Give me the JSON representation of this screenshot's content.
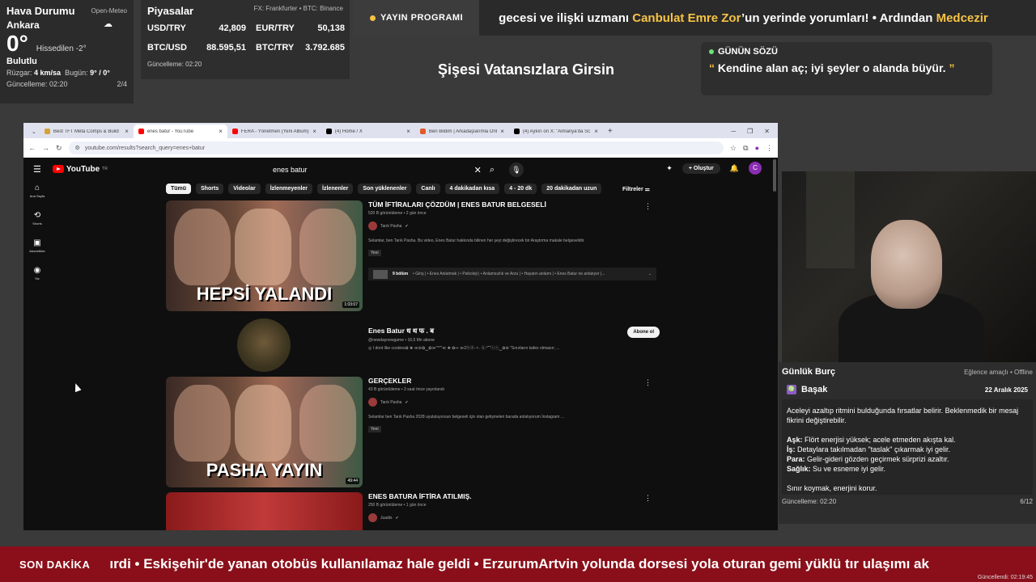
{
  "weather": {
    "title": "Hava Durumu",
    "source": "Open-Meteo",
    "city": "Ankara",
    "temp": "0°",
    "feels_like": "Hissedilen -2°",
    "condition": "Bulutlu",
    "wind_label": "Rüzgar:",
    "wind": "4 km/sa",
    "today_label": "Bugün:",
    "today": "9° / 0°",
    "updated": "Güncelleme: 02:20",
    "page": "2/4",
    "icon": "cloud-icon"
  },
  "markets": {
    "title": "Piyasalar",
    "source": "FX: Frankfurter • BTC: Binance",
    "rows": [
      {
        "label": "USD/TRY",
        "value": "42,809",
        "label2": "EUR/TRY",
        "value2": "50,138"
      },
      {
        "label": "BTC/USD",
        "value": "88.595,51",
        "label2": "BTC/TRY",
        "value2": "3.792.685"
      }
    ],
    "updated": "Güncelleme: 02:20"
  },
  "ticker_top": {
    "badge": "YAYIN PROGRAMI",
    "pre": "gecesi ve ilişki uzmanı ",
    "highlight": "Canbulat Emre Zor",
    "post": "’un yerinde yorumları!  •  Ardından ",
    "highlight2": "Medcezir"
  },
  "center_title": "Şişesi Vatansızlara Girsin",
  "quote": {
    "label": "GÜNÜN SÖZÜ",
    "open": "“",
    "text": " Kendine alan aç; iyi şeyler o alanda büyür. ",
    "close": "”"
  },
  "browser": {
    "tabs": [
      {
        "title": "Best TFT Meta Comps & Build",
        "color": "#d4a23a",
        "active": false
      },
      {
        "title": "enes batur - YouTube",
        "color": "#ff0000",
        "active": true
      },
      {
        "title": "FERA - Yönetmen (Yeni Albüm)",
        "color": "#ff0000",
        "active": false
      },
      {
        "title": "(4) Home / X",
        "color": "#000000",
        "active": false
      },
      {
        "title": "Ben Bildim | Arkadaşlarımla Onl",
        "color": "#e05a2a",
        "active": false
      },
      {
        "title": "(4) Aykırı on X: \"Almanya'da Sc",
        "color": "#000000",
        "active": false
      }
    ],
    "url": "youtube.com/results?search_query=enes+batur"
  },
  "youtube": {
    "logo": "YouTube",
    "logo_sup": "TR",
    "search_query": "enes batur",
    "create_label": "Oluştur",
    "avatar": "C",
    "chips": [
      "Tümü",
      "Shorts",
      "Videolar",
      "İzlenmeyenler",
      "İzlenenler",
      "Son yüklenenler",
      "Canlı",
      "4 dakikadan kısa",
      "4 - 20 dk",
      "20 dakikadan uzun"
    ],
    "filters_label": "Filtreler",
    "sidenav": [
      {
        "icon": "home-icon",
        "label": "Ana Sayfa"
      },
      {
        "icon": "shorts-icon",
        "label": "Shorts"
      },
      {
        "icon": "subscriptions-icon",
        "label": "Abonelikler"
      },
      {
        "icon": "you-icon",
        "label": "Siz"
      }
    ],
    "results": [
      {
        "thumb_text": "HEPSİ YALANDI",
        "duration": "1:03:07",
        "title": "TÜM İFTİRALARI ÇÖZDÜM | ENES BATUR BELGESELİ",
        "meta": "520 B görüntüleme • 2 gün önce",
        "channel": "Tarık Pasha",
        "desc": "Selamlar, ben Tarık Pasha. Bu video, Enes Batur hakkında bilinen her şeyi değiştirecek bir Araştırma makale belgeselidir.",
        "badge": "Yeni",
        "chapters_count": "9 bölüm",
        "chapters_text": "• Giriş | • Enes Anlatmak | • Psikoloji | • Anlamsızlık ve Arzu | • Hayatın anlamı | • Enes Batur ne anlatıyor |..."
      },
      {
        "channel_title": "Enes Batur ध थ फ . ब",
        "handle": "@newdaynewgame • 16,5 Mn abone",
        "desc": "◎ I dont like cookies✿ ❀ ≪⊚✿‿✿≫˜°°˜≪ ❀ ✿➺ ≫2ⓗⓖ-✧. ⓑ.°˜˜ⓒⓢ‿✿⊚ \"Sınırların kafes olmasın; ...",
        "subscribe": "Abone ol"
      },
      {
        "thumb_text": "PASHA YAYIN",
        "duration": "49:44",
        "title": "GERÇEKLER",
        "meta": "43 B görüntüleme • 3 saat önce yayınlandı",
        "channel": "Tarık Pasha",
        "desc": "Selamlar ben Tarık Pasha 2028 uyutuluyorsun belgeseli için olan gelişmeleri burada anlatıyorum İnstagram ...",
        "badge": "Yeni"
      },
      {
        "title": "ENES BATURA İFTİRA ATILMIŞ.",
        "meta": "250 B görüntüleme • 1 gün önce",
        "channel": "Juadis"
      }
    ]
  },
  "horoscope": {
    "title": "Günlük Burç",
    "status": "Eğlence amaçlı • Offline",
    "sign": "Başak",
    "sign_icon": "♍",
    "date": "22 Aralık 2025",
    "intro": "Aceleyi azaltıp ritmini bulduğunda fırsatlar belirir. Beklenmedik bir mesaj fikrini değiştirebilir.",
    "love_label": "Aşk:",
    "love": " Flört enerjisi yüksek; acele etmeden akışta kal.",
    "work_label": "İş:",
    "work": " Detaylara takılmadan \"taslak\" çıkarmak iyi gelir.",
    "money_label": "Para:",
    "money": " Gelir-gideri gözden geçirmek sürprizi azaltır.",
    "health_label": "Sağlık:",
    "health": " Su ve esneme iyi gelir.",
    "closing": "Sınır koymak, enerjini korur.",
    "updated": "Güncelleme: 02:20",
    "page": "6/12"
  },
  "ticker_bot": {
    "label": "SON DAKİKA",
    "text": "ırdi  •  Eskişehir'de yanan otobüs kullanılamaz hale geldi  •  ErzurumArtvin yolunda dorsesi yola oturan gemi yüklü tır ulaşımı ak",
    "updated": "Güncellendi: 02:19:45"
  }
}
